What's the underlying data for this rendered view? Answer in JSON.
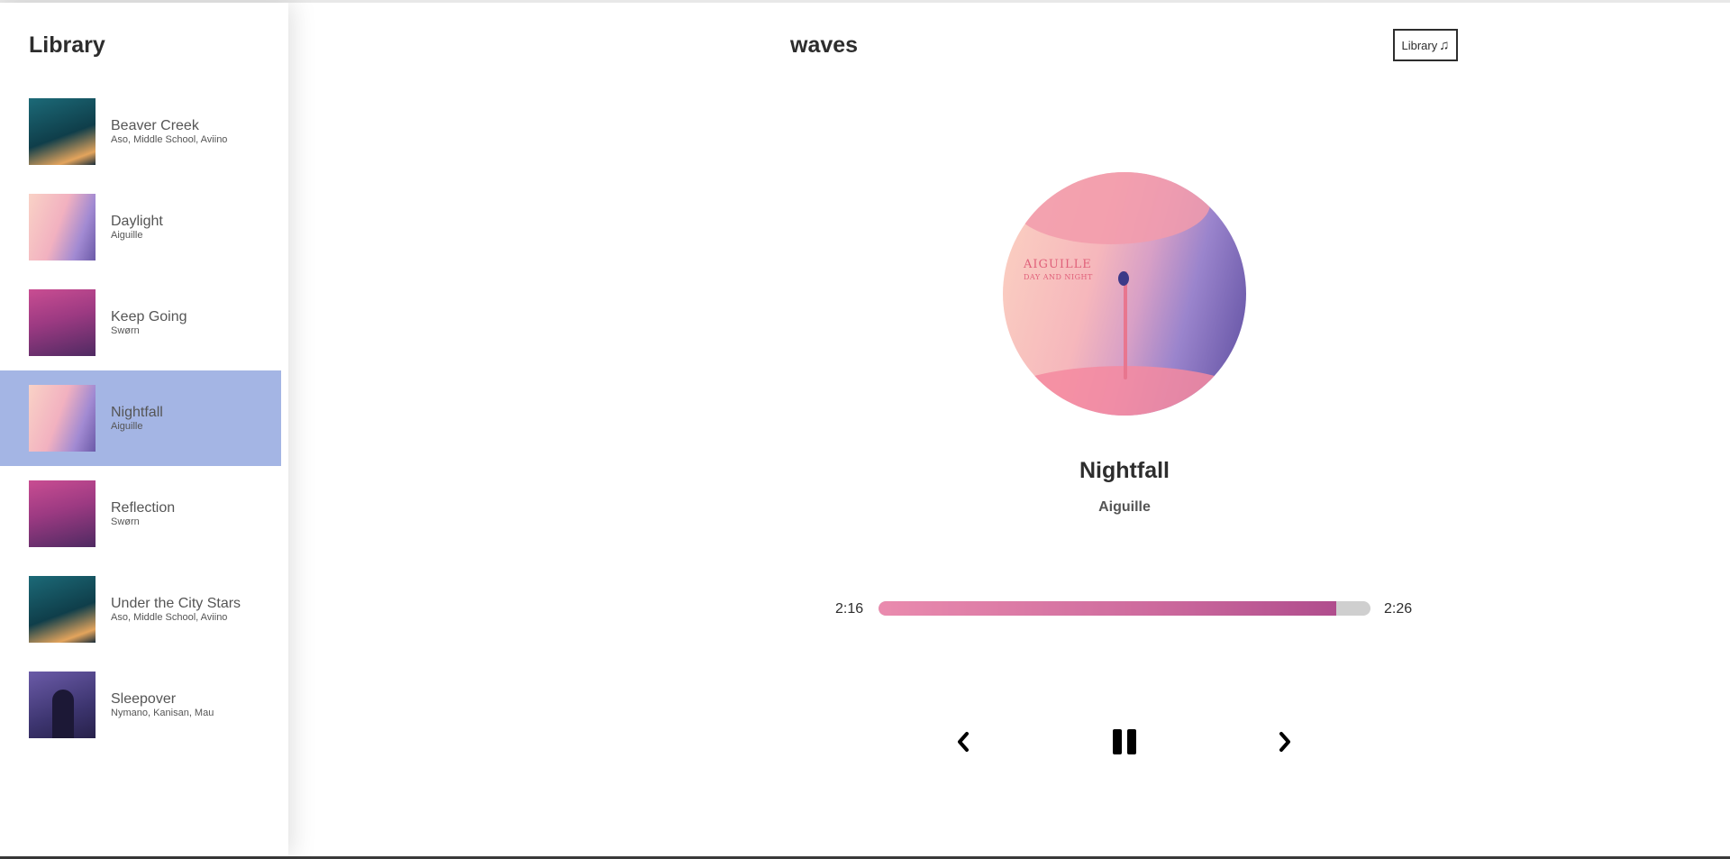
{
  "sidebar": {
    "title": "Library",
    "songs": [
      {
        "name": "Beaver Creek",
        "artist": "Aso, Middle School, Aviino",
        "cover": "teal",
        "active": false
      },
      {
        "name": "Daylight",
        "artist": "Aiguille",
        "cover": "pink",
        "active": false
      },
      {
        "name": "Keep Going",
        "artist": "Swørn",
        "cover": "magenta",
        "active": false
      },
      {
        "name": "Nightfall",
        "artist": "Aiguille",
        "cover": "pink",
        "active": true
      },
      {
        "name": "Reflection",
        "artist": "Swørn",
        "cover": "magenta",
        "active": false
      },
      {
        "name": "Under the City Stars",
        "artist": "Aso, Middle School, Aviino",
        "cover": "teal",
        "active": false
      },
      {
        "name": "Sleepover",
        "artist": "Nymano, Kanisan, Mau",
        "cover": "violet",
        "active": false
      }
    ]
  },
  "header": {
    "logo": "waves",
    "library_button": {
      "label": "Library",
      "icon": "music-note-icon"
    }
  },
  "player": {
    "track_title": "Nightfall",
    "track_artist": "Aiguille",
    "album_art_text": {
      "title": "AIGUILLE",
      "subtitle": "DAY AND NIGHT"
    },
    "current_time": "2:16",
    "total_time": "2:26",
    "progress_fraction": 0.931,
    "controls": {
      "previous": "chevron-left-icon",
      "pause": "pause-icon",
      "next": "chevron-right-icon"
    }
  },
  "colors": {
    "active_item": "#a4b5e4",
    "progress_start": "#ea8bae",
    "progress_end": "#b04d8d",
    "progress_track": "#cfcfcf",
    "text_dark": "#2d2d2d"
  }
}
